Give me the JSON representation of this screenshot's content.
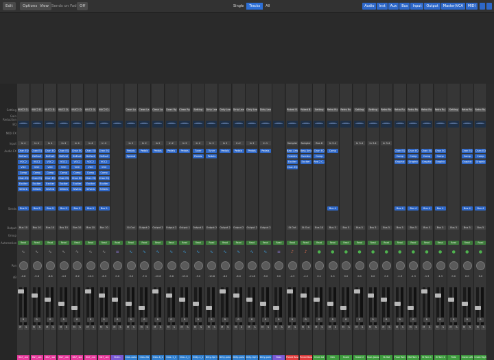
{
  "toolbar": {
    "edit": "Edit",
    "options": "Options",
    "view": "View",
    "sends_on_faders": "Sends on Faders:",
    "sends_value": "Off",
    "view_modes": [
      "Single",
      "Tracks",
      "All"
    ],
    "active_view": "Tracks",
    "filters": [
      "Audio",
      "Inst",
      "Aux",
      "Bus",
      "Input",
      "Output",
      "Master/VCA",
      "MIDI"
    ]
  },
  "row_labels": {
    "setting": "Setting",
    "gain": "Gain Reduction",
    "eq": "EQ",
    "midi": "MIDI FX",
    "input": "Input",
    "audio_fx": "Audio FX",
    "sends": "Sends",
    "output": "Output",
    "group": "Group",
    "automation": "Automation",
    "pan": "Pan",
    "db": "dB"
  },
  "strips": [
    {
      "setting": "IIIUC2 D..",
      "input": "In 4",
      "fx": [
        "Chan EQ",
        "DeEss2",
        "VGC2",
        "VGC",
        "Comp",
        "Chan EQ",
        "Exciter",
        "SilVerb"
      ],
      "send": "Bus 9",
      "output": "Bus 10",
      "auto": "Read",
      "vol": "-0.8",
      "name": "6&7_.wa",
      "color": "#e63a9b",
      "icon": "wave",
      "iconColor": "#9a9a9a"
    },
    {
      "setting": "IIIUC2 D..",
      "input": "In 4",
      "fx": [
        "Chan EQ",
        "DeEss2",
        "VGC2",
        "VGC",
        "Comp",
        "Chan EQ",
        "Exciter",
        "SilVerb"
      ],
      "send": "Bus 9",
      "output": "Bus 10",
      "auto": "Read",
      "vol": "-5.6",
      "name": "6&7_.wa",
      "color": "#e63a9b",
      "icon": "wave",
      "iconColor": "#9a9a9a"
    },
    {
      "setting": "IIIUC2 D..",
      "input": "In 4",
      "fx": [
        "Chan EQ",
        "DeEss2",
        "VGC2",
        "VGC",
        "Comp",
        "Chan EQ",
        "Exciter",
        "SilVerb"
      ],
      "send": "Bus 9",
      "output": "Bus 10",
      "auto": "Read",
      "vol": "-8.8",
      "name": "6&7_.wa",
      "color": "#e63a9b",
      "icon": "wave",
      "iconColor": "#9a9a9a"
    },
    {
      "setting": "IIIUC2 D..",
      "input": "In 4",
      "fx": [
        "Chan EQ",
        "DeEss2",
        "VGC2",
        "VGC",
        "Comp",
        "Chan EQ",
        "Exciter",
        "SilVerb"
      ],
      "send": "Bus 9",
      "output": "Bus 10",
      "auto": "Read",
      "vol": "-4.9",
      "name": "6&7_.wa",
      "color": "#e63a9b",
      "icon": "wave",
      "iconColor": "#9a9a9a"
    },
    {
      "setting": "IIIUC2 D..",
      "input": "In 4",
      "fx": [
        "Chan EQ",
        "DeEss2",
        "VGC2",
        "VGC",
        "Comp",
        "Chan EQ",
        "Exciter",
        "SilVerb"
      ],
      "send": "Bus 9",
      "output": "Bus 10",
      "auto": "Read",
      "vol": "-9.2",
      "name": "6&7_.wa",
      "color": "#e63a9b",
      "icon": "wave",
      "iconColor": "#9a9a9a"
    },
    {
      "setting": "IIIUC2 D..",
      "input": "In 4",
      "fx": [
        "Chan EQ",
        "DeEss2",
        "VGC2",
        "VGC",
        "Comp",
        "Chan EQ",
        "Exciter",
        "SilVerb"
      ],
      "send": "Bus 9",
      "output": "Bus 10",
      "auto": "Read",
      "vol": "-10.2",
      "name": "6&7_.wa",
      "color": "#e63a9b",
      "icon": "wave",
      "iconColor": "#9a9a9a"
    },
    {
      "setting": "IIIUC2 D..",
      "input": "In 4",
      "fx": [
        "Chan EQ",
        "DeEss2",
        "VGC2",
        "VGC",
        "Comp",
        "Chan EQ",
        "Exciter",
        "SilVerb"
      ],
      "send": "Bus 9",
      "output": "Bus 10",
      "auto": "Read",
      "vol": "-6.9",
      "name": "6&7_.wa",
      "color": "#e63a9b",
      "icon": "wave",
      "iconColor": "#9a9a9a"
    },
    {
      "setting": "",
      "input": "",
      "fx": [],
      "send": "",
      "output": "",
      "auto": "Read",
      "vol": "0.0",
      "name": "Stutt..",
      "color": "#7a5ad6",
      "icon": "bars",
      "iconColor": "#8d78d6"
    },
    {
      "setting": "Clean Lo..",
      "input": "In 2",
      "fx": [
        "Pedals",
        "Spread"
      ],
      "send": "",
      "output": "St Out",
      "auto": "Read",
      "vol": "-9.0",
      "name": "Clea..oolio",
      "color": "#2f7fd0",
      "icon": "wave",
      "iconColor": "#3da0e0"
    },
    {
      "setting": "Clean La..",
      "input": "In 2",
      "fx": [
        "Pedals"
      ],
      "send": "",
      "output": "Output 2",
      "auto": "Read",
      "vol": "-7.0",
      "name": "Clea..Ma",
      "color": "#2f7fd0",
      "icon": "wave",
      "iconColor": "#3da0e0"
    },
    {
      "setting": "Clean La..",
      "input": "In 2",
      "fx": [
        "Pedals"
      ],
      "send": "",
      "output": "Output 2",
      "auto": "Read",
      "vol": "-12.6",
      "name": "Clea..8_1",
      "color": "#2f7fd0",
      "icon": "wave",
      "iconColor": "#3da0e0"
    },
    {
      "setting": "Clean Ry..",
      "input": "In 2",
      "fx": [
        "Pedals"
      ],
      "send": "",
      "output": "Output 2",
      "auto": "Read",
      "vol": "-9.6",
      "name": "Clea..1_1",
      "color": "#2f7fd0",
      "icon": "wave",
      "iconColor": "#3da0e0"
    },
    {
      "setting": "Clean Ry..",
      "input": "In 2",
      "fx": [
        "Pedals"
      ],
      "send": "",
      "output": "Output 1",
      "auto": "Read",
      "vol": "-13.6",
      "name": "Clea..1_1",
      "color": "#2f7fd0",
      "icon": "wave",
      "iconColor": "#3da0e0"
    },
    {
      "setting": "Setting",
      "input": "In 2",
      "fx": [
        "Tuner",
        "Pedals"
      ],
      "send": "",
      "output": "Output 1",
      "auto": "Read",
      "vol": "-9.0",
      "name": "Dirty..1_1",
      "color": "#2f7fd0",
      "icon": "wave",
      "iconColor": "#3da0e0"
    },
    {
      "setting": "Dirty Lead",
      "input": "In 2",
      "fx": [
        "Tuner",
        "Pedals"
      ],
      "send": "",
      "output": "Output 2",
      "auto": "Read",
      "vol": "-10.8",
      "name": "Dirty..Spl 1",
      "color": "#2f7fd0",
      "icon": "wave",
      "iconColor": "#3da0e0"
    },
    {
      "setting": "Dirty Lead",
      "input": "In 2",
      "fx": [
        "Pedals"
      ],
      "send": "",
      "output": "Output 2",
      "auto": "Read",
      "vol": "-6.2",
      "name": "Dirty..polo",
      "color": "#2f7fd0",
      "icon": "wave",
      "iconColor": "#3da0e0"
    },
    {
      "setting": "Dirty Lead",
      "input": "In 2",
      "fx": [
        "Pedals"
      ],
      "send": "",
      "output": "Output 2",
      "auto": "Read",
      "vol": "-8.0",
      "name": "Dirty..polo",
      "color": "#2f7fd0",
      "icon": "wave",
      "iconColor": "#3da0e0"
    },
    {
      "setting": "Dirty Lead",
      "input": "In 2",
      "fx": [
        "Pedals"
      ],
      "send": "",
      "output": "Output 2",
      "auto": "Read",
      "vol": "-11.8",
      "name": "Dirty..Spl 1",
      "color": "#2f7fd0",
      "icon": "wave",
      "iconColor": "#3da0e0"
    },
    {
      "setting": "Dirty Lead",
      "input": "In 1",
      "fx": [
        "Pedals"
      ],
      "send": "",
      "output": "Output 2",
      "auto": "Read",
      "vol": "-9.0",
      "name": "Dirty..polo",
      "color": "#2f7fd0",
      "icon": "wave",
      "iconColor": "#3da0e0"
    },
    {
      "setting": "",
      "input": "",
      "fx": [],
      "send": "",
      "output": "",
      "auto": "Read",
      "vol": "0.0",
      "name": "Bass",
      "color": "#7a5ad6",
      "icon": "bars",
      "iconColor": "#8d78d6"
    },
    {
      "setting": "Picked B..",
      "input": "Sampler",
      "fx": [
        "Bass Amp",
        "Overdrv",
        "Exciter",
        "Chan EQ"
      ],
      "send": "",
      "output": "St Out",
      "auto": "Read",
      "vol": "-4.3",
      "name": "Picked Bass",
      "color": "#e23d3d",
      "icon": "guitar",
      "iconColor": "#e07050"
    },
    {
      "setting": "Picked B..",
      "input": "Sampler",
      "fx": [
        "Bass Amp",
        "Overdrv",
        "Exciter"
      ],
      "send": "",
      "output": "St Out",
      "auto": "Read",
      "vol": "-4.2",
      "name": "Picked Bass",
      "color": "#e23d3d",
      "icon": "guitar",
      "iconColor": "#e07050"
    },
    {
      "setting": "Setting",
      "input": "Bus 8",
      "fx": [
        "Chan EQ",
        "Comp",
        "Red 2 C.."
      ],
      "send": "",
      "output": "Bus 10",
      "auto": "Read",
      "vol": "0.1",
      "name": "Drum bd",
      "color": "#3e9c3e",
      "icon": "drum",
      "iconColor": "#4fb34f"
    },
    {
      "setting": "Retro Ru..",
      "input": "In 3-4",
      "fx": [
        "Comp"
      ],
      "send": "Bus 4",
      "output": "Bus 5",
      "auto": "Read",
      "vol": "0.0",
      "name": "Kick",
      "color": "#3e9c3e",
      "icon": "drum",
      "iconColor": "#4fb34f"
    },
    {
      "setting": "Retro Ru..",
      "input": "",
      "fx": [],
      "send": "",
      "output": "Bus 5",
      "auto": "Read",
      "vol": "0.0",
      "name": "Snare",
      "color": "#3e9c3e",
      "icon": "drum",
      "iconColor": "#4fb34f"
    },
    {
      "setting": "Setting",
      "input": "In 3-4",
      "fx": [],
      "send": "",
      "output": "Bus 5",
      "auto": "Read",
      "vol": "0.0",
      "name": "Snare 2",
      "color": "#3e9c3e",
      "icon": "drum",
      "iconColor": "#4fb34f"
    },
    {
      "setting": "Setting",
      "input": "In 3-4",
      "fx": [],
      "send": "",
      "output": "Bus 5",
      "auto": "Read",
      "vol": "0.0",
      "name": "Snar..Jaxxs",
      "color": "#3e9c3e",
      "icon": "drum",
      "iconColor": "#4fb34f"
    },
    {
      "setting": "Retro Ru..",
      "input": "In 3-4",
      "fx": [],
      "send": "",
      "output": "Bus 5",
      "auto": "Read",
      "vol": "0.0",
      "name": "Hi-Hat",
      "color": "#3e9c3e",
      "icon": "drum",
      "iconColor": "#4fb34f"
    },
    {
      "setting": "Retro Ru..",
      "input": "",
      "fx": [
        "Chan EQ",
        "Comp",
        "Graphic"
      ],
      "send": "Bus 4",
      "output": "Bus 5",
      "auto": "Read",
      "vol": "-1.3",
      "name": "Floor Tom",
      "color": "#3e9c3e",
      "icon": "drum",
      "iconColor": "#4fb34f"
    },
    {
      "setting": "Retro Ru..",
      "input": "",
      "fx": [
        "Chan EQ",
        "Comp",
        "Graphic"
      ],
      "send": "Bus 4",
      "output": "Bus 5",
      "auto": "Read",
      "vol": "-1.3",
      "name": "Mid Tom 1",
      "color": "#3e9c3e",
      "icon": "drum",
      "iconColor": "#4fb34f"
    },
    {
      "setting": "Retro Ru..",
      "input": "",
      "fx": [
        "Chan EQ",
        "Comp",
        "Graphic"
      ],
      "send": "Bus 4",
      "output": "Bus 5",
      "auto": "Read",
      "vol": "-1.3",
      "name": "Hi Tom 1",
      "color": "#3e9c3e",
      "icon": "drum",
      "iconColor": "#4fb34f"
    },
    {
      "setting": "Retro Ru..",
      "input": "",
      "fx": [
        "Chan EQ",
        "Comp",
        "Graphic"
      ],
      "send": "Bus 4",
      "output": "Bus 5",
      "auto": "Read",
      "vol": "-1.3",
      "name": "Hi Tom 2",
      "color": "#3e9c3e",
      "icon": "drum",
      "iconColor": "#4fb34f"
    },
    {
      "setting": "Setting",
      "input": "",
      "fx": [],
      "send": "",
      "output": "Bus 5",
      "auto": "Read",
      "vol": "0.0",
      "name": "Ride",
      "color": "#3e9c3e",
      "icon": "drum",
      "iconColor": "#4fb34f"
    },
    {
      "setting": "Retro Ru..",
      "input": "",
      "fx": [
        "Chan EQ",
        "Comp",
        "Graphic"
      ],
      "send": "Bus 4",
      "output": "Bus 5",
      "auto": "Read",
      "vol": "0.0",
      "name": "Crash Left",
      "color": "#3e9c3e",
      "icon": "drum",
      "iconColor": "#4fb34f"
    },
    {
      "setting": "Retro Ru..",
      "input": "",
      "fx": [
        "Chan EQ",
        "Comp",
        "Graphic"
      ],
      "send": "Bus 4",
      "output": "Bus 5",
      "auto": "Read",
      "vol": "0.0",
      "name": "Crash Right",
      "color": "#3e9c3e",
      "icon": "drum",
      "iconColor": "#4fb34f"
    }
  ]
}
